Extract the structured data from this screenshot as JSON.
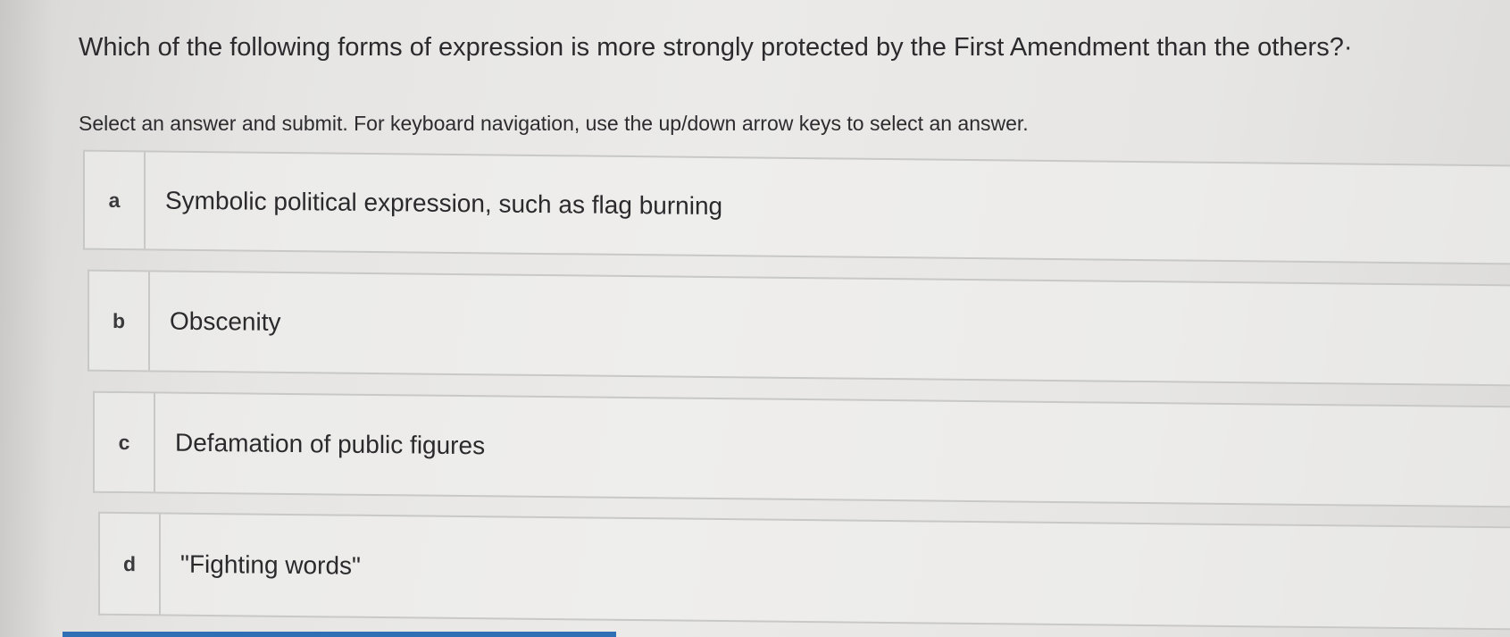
{
  "question": {
    "text": "Which of the following forms of expression is more strongly protected by the First Amendment than the others?·",
    "instructions": "Select an answer and submit. For keyboard navigation, use the up/down arrow keys to select an answer."
  },
  "options": [
    {
      "letter": "a",
      "text": "Symbolic political expression, such as flag burning"
    },
    {
      "letter": "b",
      "text": "Obscenity"
    },
    {
      "letter": "c",
      "text": "Defamation of public figures"
    },
    {
      "letter": "d",
      "text": "\"Fighting words\""
    }
  ],
  "colors": {
    "border": "#c8c8c6",
    "text": "#2a2a2d",
    "accent_bar": "#2f6fb5"
  }
}
